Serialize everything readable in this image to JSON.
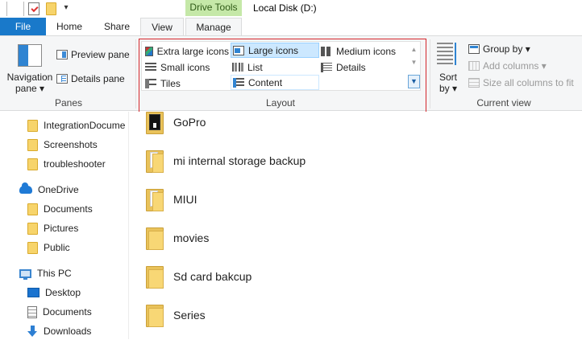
{
  "window": {
    "title": "Local Disk (D:)",
    "contextual_tab": "Drive Tools",
    "quick_access_dropdown": "▾"
  },
  "tabs": {
    "file": "File",
    "home": "Home",
    "share": "Share",
    "view": "View",
    "manage": "Manage"
  },
  "ribbon": {
    "panes": {
      "group_label": "Panes",
      "navigation_pane_line1": "Navigation",
      "navigation_pane_line2": "pane ▾",
      "preview_pane": "Preview pane",
      "details_pane": "Details pane"
    },
    "layout": {
      "group_label": "Layout",
      "items": [
        "Extra large icons",
        "Large icons",
        "Medium icons",
        "Small icons",
        "List",
        "Details",
        "Tiles",
        "Content"
      ],
      "selected": "Large icons"
    },
    "current_view": {
      "group_label": "Current view",
      "sort_by_line1": "Sort",
      "sort_by_line2": "by ▾",
      "group_by": "Group by ▾",
      "add_columns": "Add columns ▾",
      "size_all_columns": "Size all columns to fit"
    }
  },
  "nav_pane": {
    "items": [
      "IntegrationDocume",
      "Screenshots",
      "troubleshooter",
      "OneDrive",
      "Documents",
      "Pictures",
      "Public",
      "This PC",
      "Desktop",
      "Documents",
      "Downloads"
    ]
  },
  "files": [
    "GoPro",
    "mi internal storage backup",
    "MIUI",
    "movies",
    "Sd card bakcup",
    "Series"
  ],
  "colors": {
    "file_tab": "#1979ca",
    "contextual_tab": "#c5e8a8",
    "selection": "#cce8ff",
    "highlight_box": "#d4262b"
  }
}
